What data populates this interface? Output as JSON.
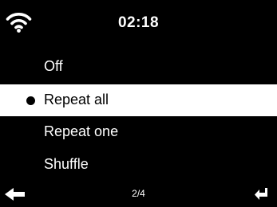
{
  "status": {
    "time": "02:18",
    "wifi_icon": "wifi-icon"
  },
  "menu": {
    "items": [
      {
        "label": "Off",
        "selected": false
      },
      {
        "label": "Repeat all",
        "selected": true
      },
      {
        "label": "Repeat one",
        "selected": false
      },
      {
        "label": "Shuffle",
        "selected": false
      }
    ]
  },
  "footer": {
    "page": "2/4",
    "back_icon": "back-arrow-icon",
    "enter_icon": "enter-icon"
  },
  "colors": {
    "background": "#000000",
    "text": "#ffffff",
    "highlight": "#ffffff",
    "highlight_text": "#000000"
  }
}
